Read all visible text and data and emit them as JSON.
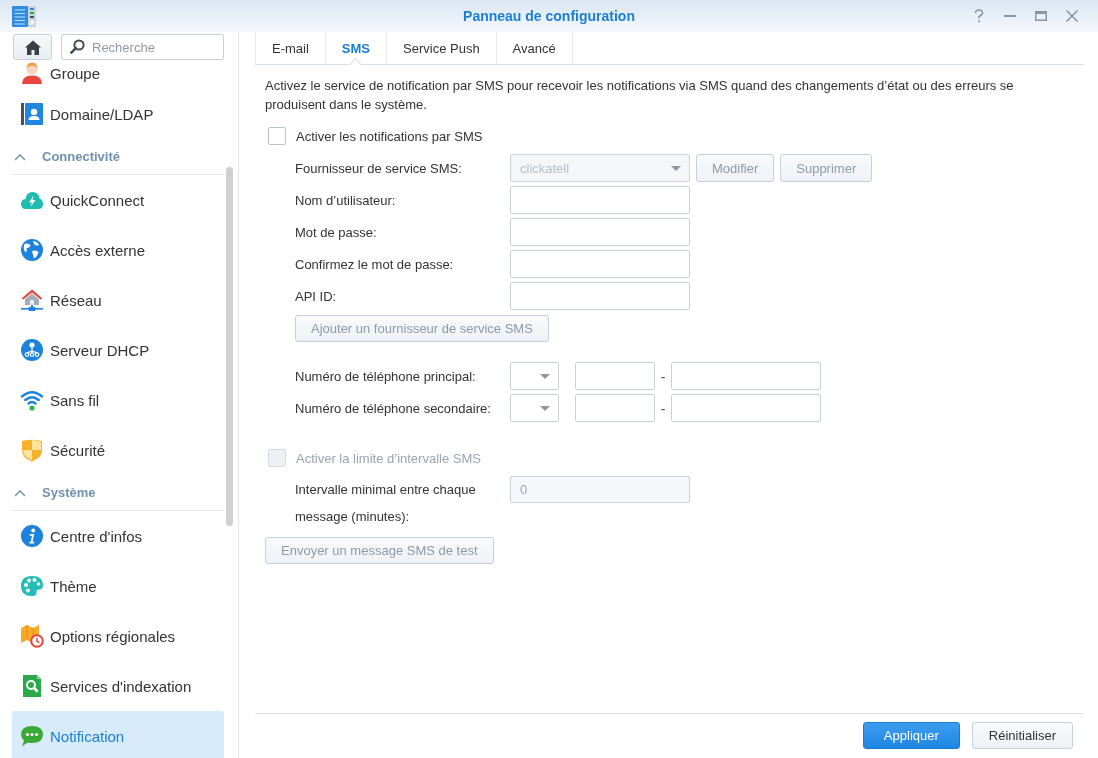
{
  "window": {
    "title": "Panneau de configuration"
  },
  "sidebar": {
    "search": {
      "placeholder": "Recherche"
    },
    "sections": [
      {
        "items": [
          {
            "label": "Groupe",
            "selected": false
          },
          {
            "label": "Domaine/LDAP",
            "selected": false
          }
        ]
      },
      {
        "title": "Connectivité",
        "expanded": true,
        "items": [
          {
            "label": "QuickConnect",
            "selected": false
          },
          {
            "label": "Accès externe",
            "selected": false
          },
          {
            "label": "Réseau",
            "selected": false
          },
          {
            "label": "Serveur DHCP",
            "selected": false
          },
          {
            "label": "Sans fil",
            "selected": false
          },
          {
            "label": "Sécurité",
            "selected": false
          }
        ]
      },
      {
        "title": "Système",
        "expanded": true,
        "items": [
          {
            "label": "Centre d'infos",
            "selected": false
          },
          {
            "label": "Thème",
            "selected": false
          },
          {
            "label": "Options régionales",
            "selected": false
          },
          {
            "label": "Services d'indexation",
            "selected": false
          },
          {
            "label": "Notification",
            "selected": true
          }
        ]
      }
    ]
  },
  "tabs": [
    {
      "label": "E-mail",
      "selected": false
    },
    {
      "label": "SMS",
      "selected": true
    },
    {
      "label": "Service Push",
      "selected": false
    },
    {
      "label": "Avancé",
      "selected": false
    }
  ],
  "sms": {
    "description": "Activez le service de notification par SMS pour recevoir les notifications via SMS quand des changements d’état ou des erreurs se produisent dans le système.",
    "enable": {
      "label": "Activer les notifications par SMS",
      "checked": false
    },
    "provider": {
      "label": "Fournisseur de service SMS:",
      "value": "clickatell",
      "disabled": true
    },
    "provider_buttons": [
      {
        "label": "Modifier",
        "disabled": true
      },
      {
        "label": "Supprimer",
        "disabled": true
      }
    ],
    "fields": [
      {
        "label": "Nom d’utilisateur:"
      },
      {
        "label": "Mot de passe:"
      },
      {
        "label": "Confirmez le mot de passe:"
      },
      {
        "label": "API ID:"
      }
    ],
    "add_provider_button": {
      "label": "Ajouter un fournisseur de service SMS",
      "disabled": true
    },
    "phones": [
      {
        "label": "Numéro de téléphone principal:",
        "separator": "-"
      },
      {
        "label": "Numéro de téléphone secondaire:",
        "separator": "-"
      }
    ],
    "interval_limit": {
      "label": "Activer la limite d’intervalle SMS",
      "checked": false,
      "disabled": true
    },
    "interval": {
      "label": "Intervalle minimal entre chaque message (minutes):",
      "value": "0",
      "disabled": true
    },
    "test_button": {
      "label": "Envoyer un message SMS de test",
      "disabled": true
    }
  },
  "footer": {
    "buttons": [
      {
        "label": "Appliquer",
        "kind": "primary"
      },
      {
        "label": "Réinitialiser",
        "kind": "secondary"
      }
    ]
  }
}
